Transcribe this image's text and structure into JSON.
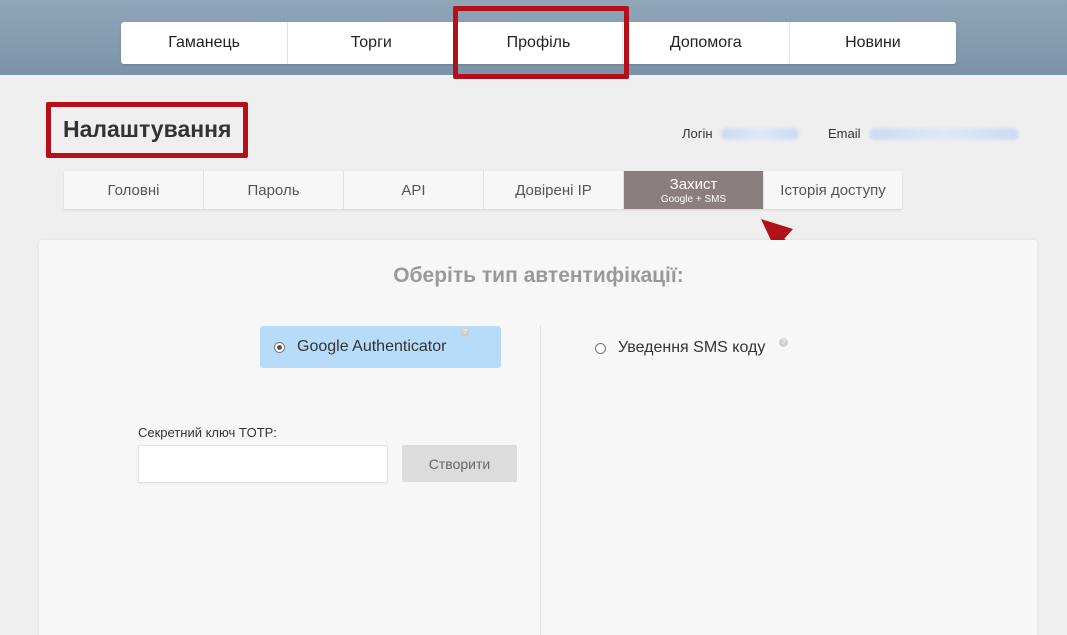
{
  "main_nav": {
    "items": [
      {
        "label": "Гаманець"
      },
      {
        "label": "Торги"
      },
      {
        "label": "Профіль"
      },
      {
        "label": "Допомога"
      },
      {
        "label": "Новини"
      }
    ]
  },
  "page": {
    "title": "Налаштування",
    "login_label": "Логін",
    "email_label": "Email"
  },
  "sub_tabs": {
    "items": [
      {
        "label": "Головні",
        "sub": ""
      },
      {
        "label": "Пароль",
        "sub": ""
      },
      {
        "label": "API",
        "sub": ""
      },
      {
        "label": "Довірені IP",
        "sub": ""
      },
      {
        "label": "Захист",
        "sub": "Google + SMS"
      },
      {
        "label": "Історія доступу",
        "sub": ""
      }
    ],
    "active_index": 4
  },
  "auth": {
    "heading": "Оберіть тип автентифікації:",
    "option_google": "Google Authenticator",
    "option_sms": "Уведення SMS коду",
    "help_glyph": "?",
    "totp_label": "Секретний ключ TOTP:",
    "totp_value": "",
    "create_button": "Створити"
  },
  "colors": {
    "annotation": "#b3101a",
    "active_tab": "#8b7e7f",
    "selected_option": "#b7dcf9"
  },
  "icons": {
    "help": "help-icon",
    "radio": "radio-icon",
    "arrow": "arrow-annotation"
  }
}
